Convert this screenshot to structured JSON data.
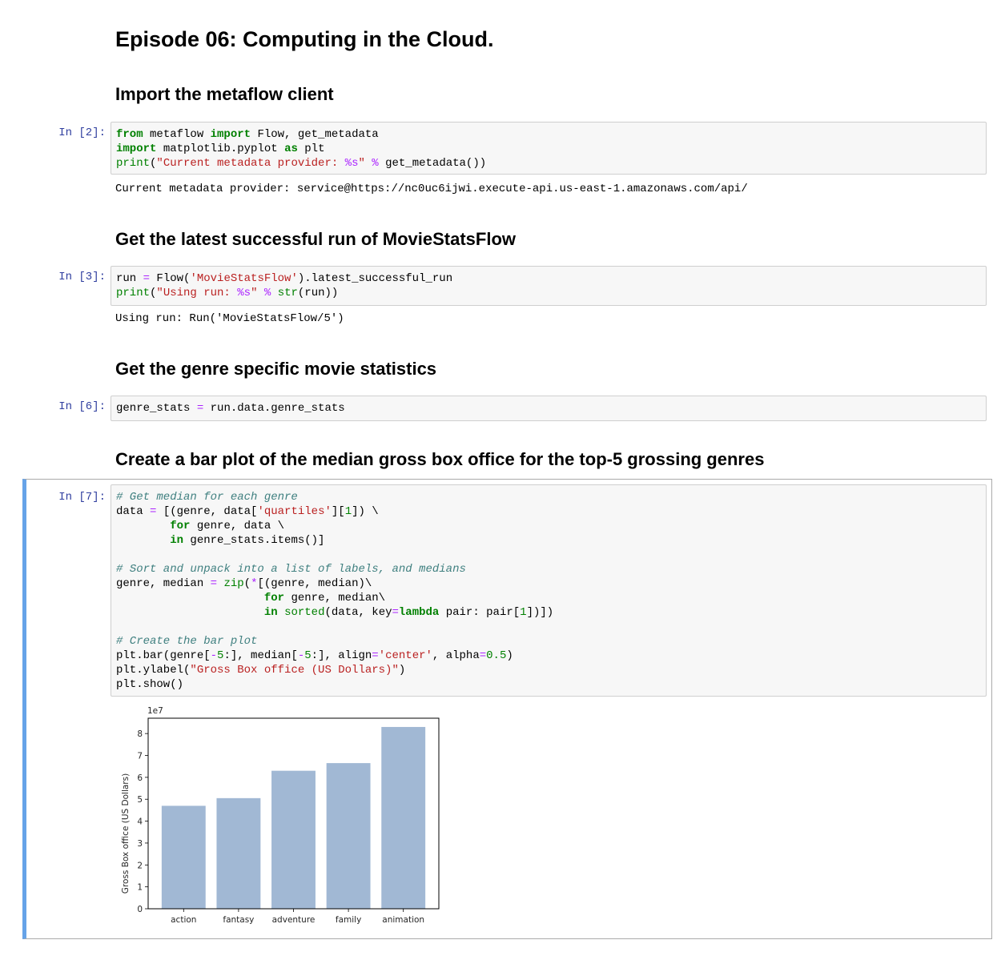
{
  "notebook": {
    "title": "Episode 06: Computing in the Cloud.",
    "cells": [
      {
        "heading": "Import the metaflow client",
        "prompt": "In [2]:",
        "code_lines": [
          "from metaflow import Flow, get_metadata",
          "import matplotlib.pyplot as plt",
          "print(\"Current metadata provider: %s\" % get_metadata())"
        ],
        "output": "Current metadata provider: service@https://nc0uc6ijwi.execute-api.us-east-1.amazonaws.com/api/"
      },
      {
        "heading": "Get the latest successful run of MovieStatsFlow",
        "prompt": "In [3]:",
        "code_lines": [
          "run = Flow('MovieStatsFlow').latest_successful_run",
          "print(\"Using run: %s\" % str(run))"
        ],
        "output": "Using run: Run('MovieStatsFlow/5')"
      },
      {
        "heading": "Get the genre specific movie statistics",
        "prompt": "In [6]:",
        "code_lines": [
          "genre_stats = run.data.genre_stats"
        ]
      },
      {
        "heading": "Create a bar plot of the median gross box office for the top-5 grossing genres",
        "prompt": "In [7]:",
        "code_lines": [
          "# Get median for each genre",
          "data = [(genre, data['quartiles'][1]) \\",
          "        for genre, data \\",
          "        in genre_stats.items()]",
          "",
          "# Sort and unpack into a list of labels, and medians",
          "genre, median = zip(*[(genre, median)\\",
          "                      for genre, median\\",
          "                      in sorted(data, key=lambda pair: pair[1])])",
          "",
          "# Create the bar plot",
          "plt.bar(genre[-5:], median[-5:], align='center', alpha=0.5)",
          "plt.ylabel(\"Gross Box office (US Dollars)\")",
          "plt.show()"
        ]
      }
    ]
  },
  "chart_data": {
    "type": "bar",
    "categories": [
      "action",
      "fantasy",
      "adventure",
      "family",
      "animation"
    ],
    "values": [
      4.7,
      5.05,
      6.3,
      6.65,
      8.3
    ],
    "scale_label": "1e7",
    "ylabel": "Gross Box office (US Dollars)",
    "xlabel": "",
    "title": "",
    "ylim": [
      0,
      8.7
    ],
    "yticks": [
      0,
      1,
      2,
      3,
      4,
      5,
      6,
      7,
      8
    ],
    "bar_color": "#a1b8d4",
    "grid": false
  }
}
